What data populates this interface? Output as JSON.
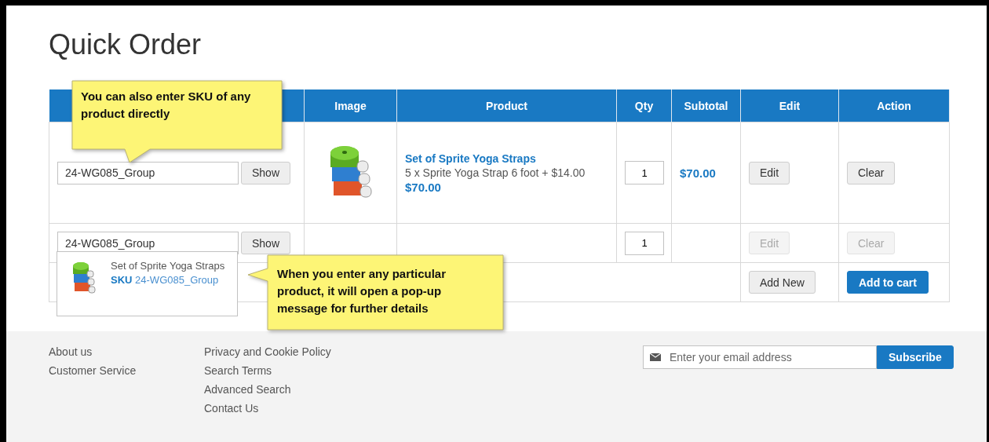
{
  "page": {
    "title": "Quick Order"
  },
  "table": {
    "columns": [
      "Image",
      "Product",
      "Qty",
      "Subtotal",
      "Edit",
      "Action"
    ],
    "rows": [
      {
        "kind": "product",
        "sku": "24-WG085_Group",
        "show_button": "Show",
        "product_name": "Set of Sprite Yoga Straps",
        "option": "5 x Sprite Yoga Strap 6 foot + $14.00",
        "price": "$70.00",
        "qty": "1",
        "subtotal": "$70.00",
        "edit": {
          "label": "Edit",
          "disabled": false
        },
        "clear": {
          "label": "Clear",
          "disabled": false
        }
      },
      {
        "kind": "empty",
        "sku": "24-WG085_Group",
        "show_button": "Show",
        "qty": "1",
        "edit": {
          "label": "Edit",
          "disabled": true
        },
        "clear": {
          "label": "Clear",
          "disabled": true
        }
      }
    ],
    "add_new": "Add New",
    "add_to_cart": "Add to cart"
  },
  "autocomplete": {
    "name": "Set of Sprite Yoga Straps",
    "sku_label": "SKU",
    "sku": "24-WG085_Group"
  },
  "callouts": [
    {
      "text": "You can also enter SKU of any product directly"
    },
    {
      "text": "When you enter any particular product, it will open a pop-up message for further details"
    }
  ],
  "footer": {
    "columns": [
      [
        "About us",
        "Customer Service"
      ],
      [
        "Privacy and Cookie Policy",
        "Search Terms",
        "Advanced Search",
        "Contact Us"
      ]
    ],
    "newsletter": {
      "placeholder": "Enter your email address",
      "button": "Subscribe"
    }
  }
}
